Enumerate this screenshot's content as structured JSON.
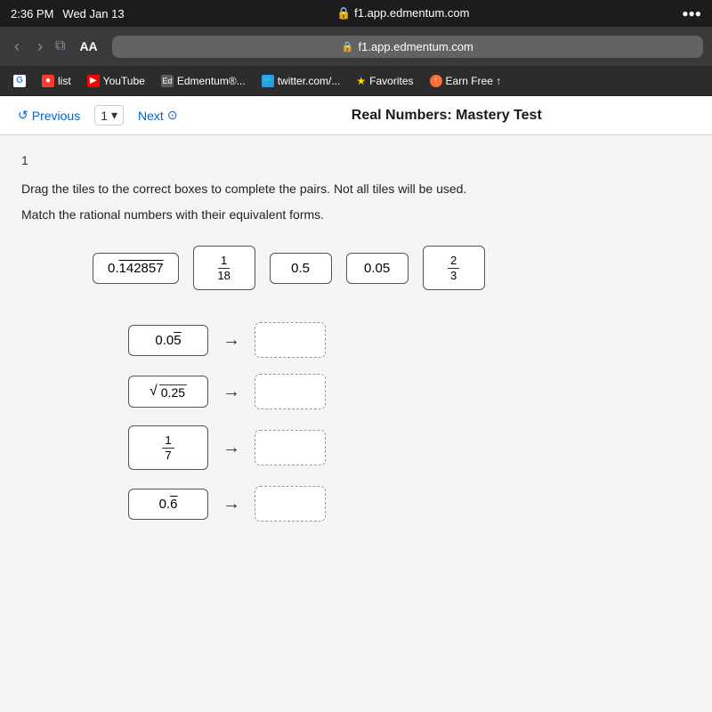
{
  "statusBar": {
    "time": "2:36 PM",
    "date": "Wed Jan 13",
    "url": "f1.app.edmentum.com"
  },
  "bookmarks": [
    {
      "id": "bm-list",
      "label": "list",
      "iconType": "red"
    },
    {
      "id": "bm-youtube",
      "label": "YouTube",
      "iconType": "yt"
    },
    {
      "id": "bm-edmentum",
      "label": "Edmentum®...",
      "iconType": "em"
    },
    {
      "id": "bm-twitter",
      "label": "twitter.com/...",
      "iconType": "tw"
    },
    {
      "id": "bm-favorites",
      "label": "Favorites",
      "iconType": "star"
    },
    {
      "id": "bm-earnfree",
      "label": "Earn Free ↑",
      "iconType": "orange"
    }
  ],
  "navBar": {
    "prevLabel": "Previous",
    "nextLabel": "Next",
    "pageNumber": "1",
    "pageTitle": "Real Numbers: Mastery Test"
  },
  "question": {
    "number": "1",
    "instruction1": "Drag the tiles to the correct boxes to complete the pairs. Not all tiles will be used.",
    "instruction2": "Match the rational numbers with their equivalent forms.",
    "tiles": [
      {
        "id": "tile-1",
        "display": "0.142857",
        "type": "decimal-overline",
        "value": "0.142857"
      },
      {
        "id": "tile-2",
        "display": "1/18",
        "type": "fraction"
      },
      {
        "id": "tile-3",
        "display": "0.5",
        "type": "decimal"
      },
      {
        "id": "tile-4",
        "display": "0.05",
        "type": "decimal"
      },
      {
        "id": "tile-5",
        "display": "2/3",
        "type": "fraction"
      }
    ],
    "matchRows": [
      {
        "id": "row-1",
        "source": "0.0̄5̄",
        "sourceType": "decimal-overline-05",
        "target": ""
      },
      {
        "id": "row-2",
        "source": "√0.25",
        "sourceType": "sqrt",
        "target": ""
      },
      {
        "id": "row-3",
        "source": "1/7",
        "sourceType": "fraction",
        "target": ""
      },
      {
        "id": "row-4",
        "source": "0.6̄",
        "sourceType": "decimal-overline-6",
        "target": ""
      }
    ]
  },
  "colors": {
    "navBlue": "#0066cc",
    "tileBorder": "#555",
    "targetBorder": "#999"
  }
}
